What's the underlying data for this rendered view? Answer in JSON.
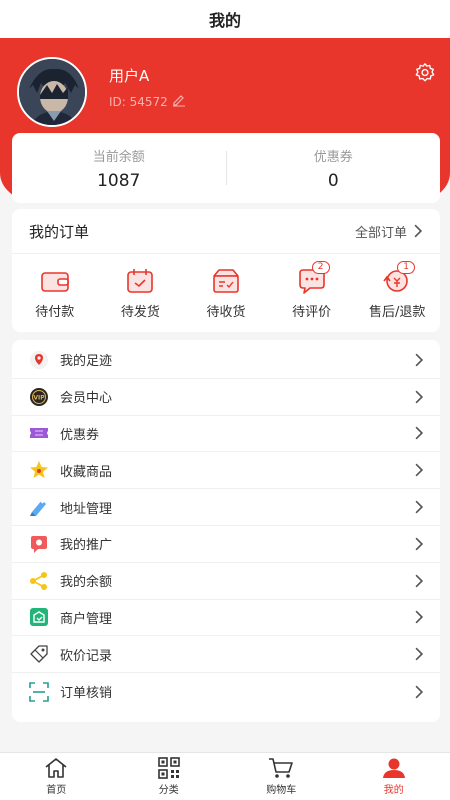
{
  "header": {
    "title": "我的"
  },
  "profile": {
    "name": "用户A",
    "id_text": "ID: 54572"
  },
  "balance": [
    {
      "label": "当前余额",
      "value": "1087"
    },
    {
      "label": "优惠券",
      "value": "0"
    }
  ],
  "orders": {
    "title": "我的订单",
    "all_label": "全部订单",
    "items": [
      {
        "label": "待付款",
        "icon": "wallet-icon",
        "badge": ""
      },
      {
        "label": "待发货",
        "icon": "calendar-box-icon",
        "badge": ""
      },
      {
        "label": "待收货",
        "icon": "package-icon",
        "badge": ""
      },
      {
        "label": "待评价",
        "icon": "comment-icon",
        "badge": "2"
      },
      {
        "label": "售后/退款",
        "icon": "refund-icon",
        "badge": "1"
      }
    ]
  },
  "menu": [
    {
      "label": "我的足迹",
      "icon": "location-pin-icon"
    },
    {
      "label": "会员中心",
      "icon": "vip-icon"
    },
    {
      "label": "优惠券",
      "icon": "coupon-icon"
    },
    {
      "label": "收藏商品",
      "icon": "star-icon"
    },
    {
      "label": "地址管理",
      "icon": "address-pen-icon"
    },
    {
      "label": "我的推广",
      "icon": "promotion-icon"
    },
    {
      "label": "我的余额",
      "icon": "share-nodes-icon"
    },
    {
      "label": "商户管理",
      "icon": "merchant-icon"
    },
    {
      "label": "砍价记录",
      "icon": "bargain-tag-icon"
    },
    {
      "label": "订单核销",
      "icon": "scan-icon"
    }
  ],
  "tabs": [
    {
      "label": "首页",
      "icon": "home-icon"
    },
    {
      "label": "分类",
      "icon": "qrcode-icon"
    },
    {
      "label": "购物车",
      "icon": "cart-icon"
    },
    {
      "label": "我的",
      "icon": "user-icon",
      "active": true
    }
  ],
  "colors": {
    "primary": "#e8362d",
    "background": "#f5f5f5"
  }
}
